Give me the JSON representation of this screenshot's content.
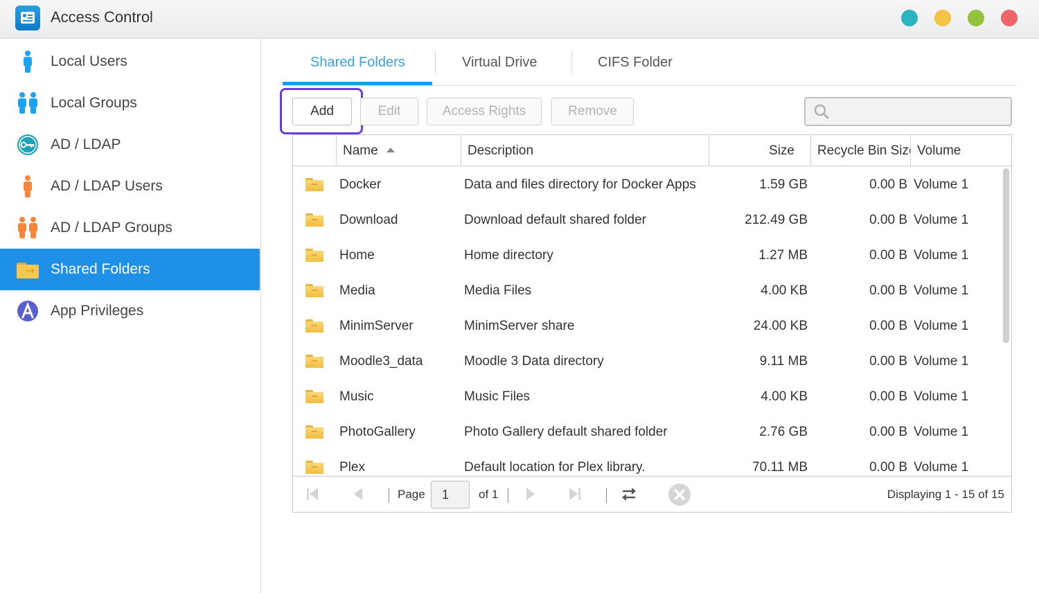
{
  "window": {
    "title": "Access Control",
    "dots": [
      "#2bb3c0",
      "#f5c343",
      "#93c23c",
      "#f0656a"
    ]
  },
  "sidebar": {
    "items": [
      {
        "label": "Local Users"
      },
      {
        "label": "Local Groups"
      },
      {
        "label": "AD / LDAP"
      },
      {
        "label": "AD / LDAP Users"
      },
      {
        "label": "AD / LDAP Groups"
      },
      {
        "label": "Shared Folders"
      },
      {
        "label": "App Privileges"
      }
    ],
    "active_index": 5
  },
  "tabs": [
    {
      "label": "Shared Folders"
    },
    {
      "label": "Virtual Drive"
    },
    {
      "label": "CIFS Folder"
    }
  ],
  "toolbar": {
    "add": "Add",
    "edit": "Edit",
    "access_rights": "Access Rights",
    "remove": "Remove",
    "search_placeholder": ""
  },
  "grid": {
    "columns": {
      "name": "Name",
      "description": "Description",
      "size": "Size",
      "recycle": "Recycle Bin Size",
      "volume": "Volume"
    },
    "rows": [
      {
        "name": "Docker",
        "description": "Data and files directory for Docker Apps",
        "size": "1.59 GB",
        "recycle": "0.00 B",
        "volume": "Volume 1"
      },
      {
        "name": "Download",
        "description": "Download default shared folder",
        "size": "212.49 GB",
        "recycle": "0.00 B",
        "volume": "Volume 1"
      },
      {
        "name": "Home",
        "description": "Home directory",
        "size": "1.27 MB",
        "recycle": "0.00 B",
        "volume": "Volume 1"
      },
      {
        "name": "Media",
        "description": "Media Files",
        "size": "4.00 KB",
        "recycle": "0.00 B",
        "volume": "Volume 1"
      },
      {
        "name": "MinimServer",
        "description": "MinimServer share",
        "size": "24.00 KB",
        "recycle": "0.00 B",
        "volume": "Volume 1"
      },
      {
        "name": "Moodle3_data",
        "description": "Moodle 3 Data directory",
        "size": "9.11 MB",
        "recycle": "0.00 B",
        "volume": "Volume 1"
      },
      {
        "name": "Music",
        "description": "Music Files",
        "size": "4.00 KB",
        "recycle": "0.00 B",
        "volume": "Volume 1"
      },
      {
        "name": "PhotoGallery",
        "description": "Photo Gallery default shared folder",
        "size": "2.76 GB",
        "recycle": "0.00 B",
        "volume": "Volume 1"
      },
      {
        "name": "Plex",
        "description": "Default location for Plex library.",
        "size": "70.11 MB",
        "recycle": "0.00 B",
        "volume": "Volume 1"
      }
    ]
  },
  "pager": {
    "page_label": "Page",
    "page_value": "1",
    "of_label": "of 1",
    "display": "Displaying 1 - 15 of 15"
  },
  "colors": {
    "accent": "#1e90e8",
    "highlight": "#6b3fd6",
    "folder": "#f0bd3e"
  }
}
